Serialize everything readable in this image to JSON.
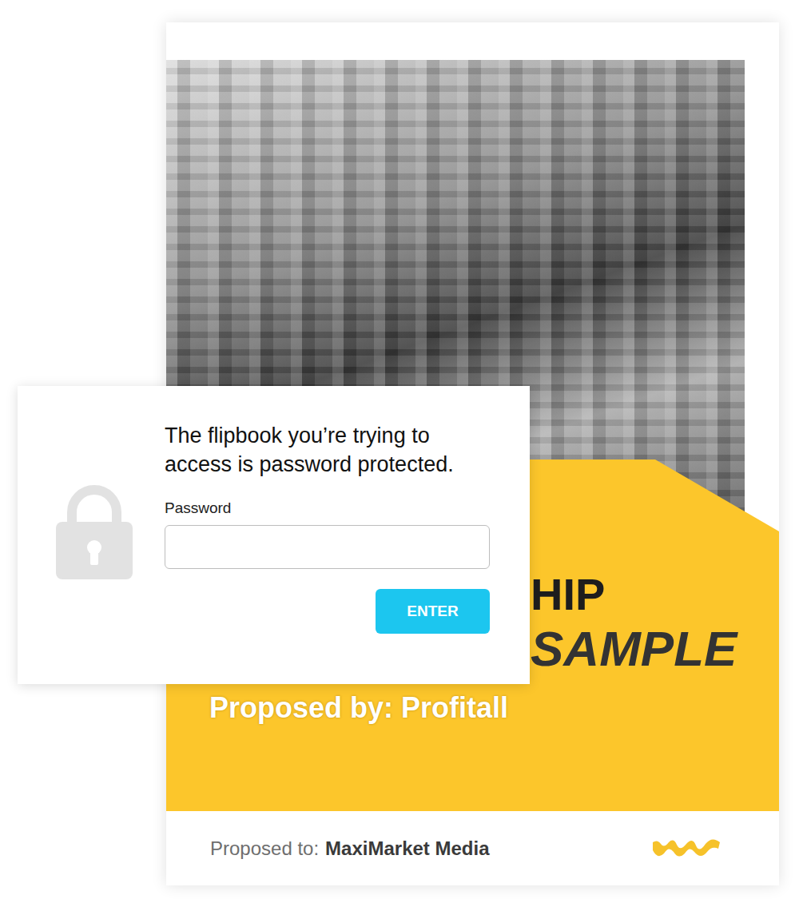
{
  "dialog": {
    "message": "The flipbook you’re trying to access is password protected.",
    "field_label": "Password",
    "field_value": "",
    "button": "ENTER"
  },
  "cover": {
    "title_lines": [
      "HIP",
      "SAMPLE"
    ],
    "proposed_by": "Proposed by: Profitall",
    "proposed_to_label": "Proposed to:",
    "proposed_to": "MaxiMarket Media"
  }
}
